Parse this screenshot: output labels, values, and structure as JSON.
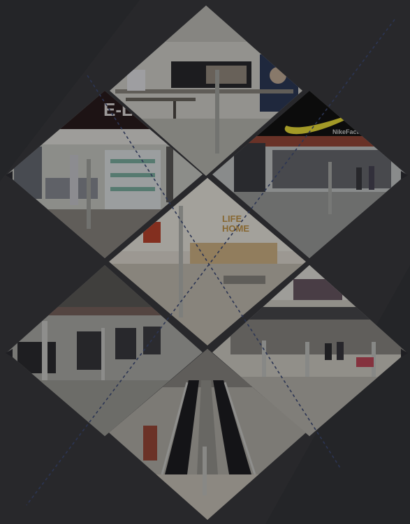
{
  "collage": {
    "background_color": "#3b3c40",
    "overlay_color": "#000000",
    "overlay_opacity": 0.32,
    "dash_color": "#2c3553"
  },
  "tiles": [
    {
      "name": "tile-store-top",
      "scene": "store interior with display counters and wall posters"
    },
    {
      "name": "tile-elife-store",
      "scene": "clothing store with E-LIFE sign and security gates"
    },
    {
      "name": "tile-nike-factory",
      "scene": "Nike factory store entrance with security gates"
    },
    {
      "name": "tile-home-store-lobby",
      "scene": "home store lobby with reception desk and security gate"
    },
    {
      "name": "tile-supermarket-checkout",
      "scene": "supermarket checkout lanes"
    },
    {
      "name": "tile-mall-corridor",
      "scene": "mall corridor with security gates and shoppers"
    },
    {
      "name": "tile-escalator",
      "scene": "escalator with security gates at bottom"
    }
  ],
  "signs": {
    "elife": "E-LI",
    "nike_factory": "NikeFactory",
    "home_store_line1": "LIFE",
    "home_store_line2": "HOME"
  }
}
